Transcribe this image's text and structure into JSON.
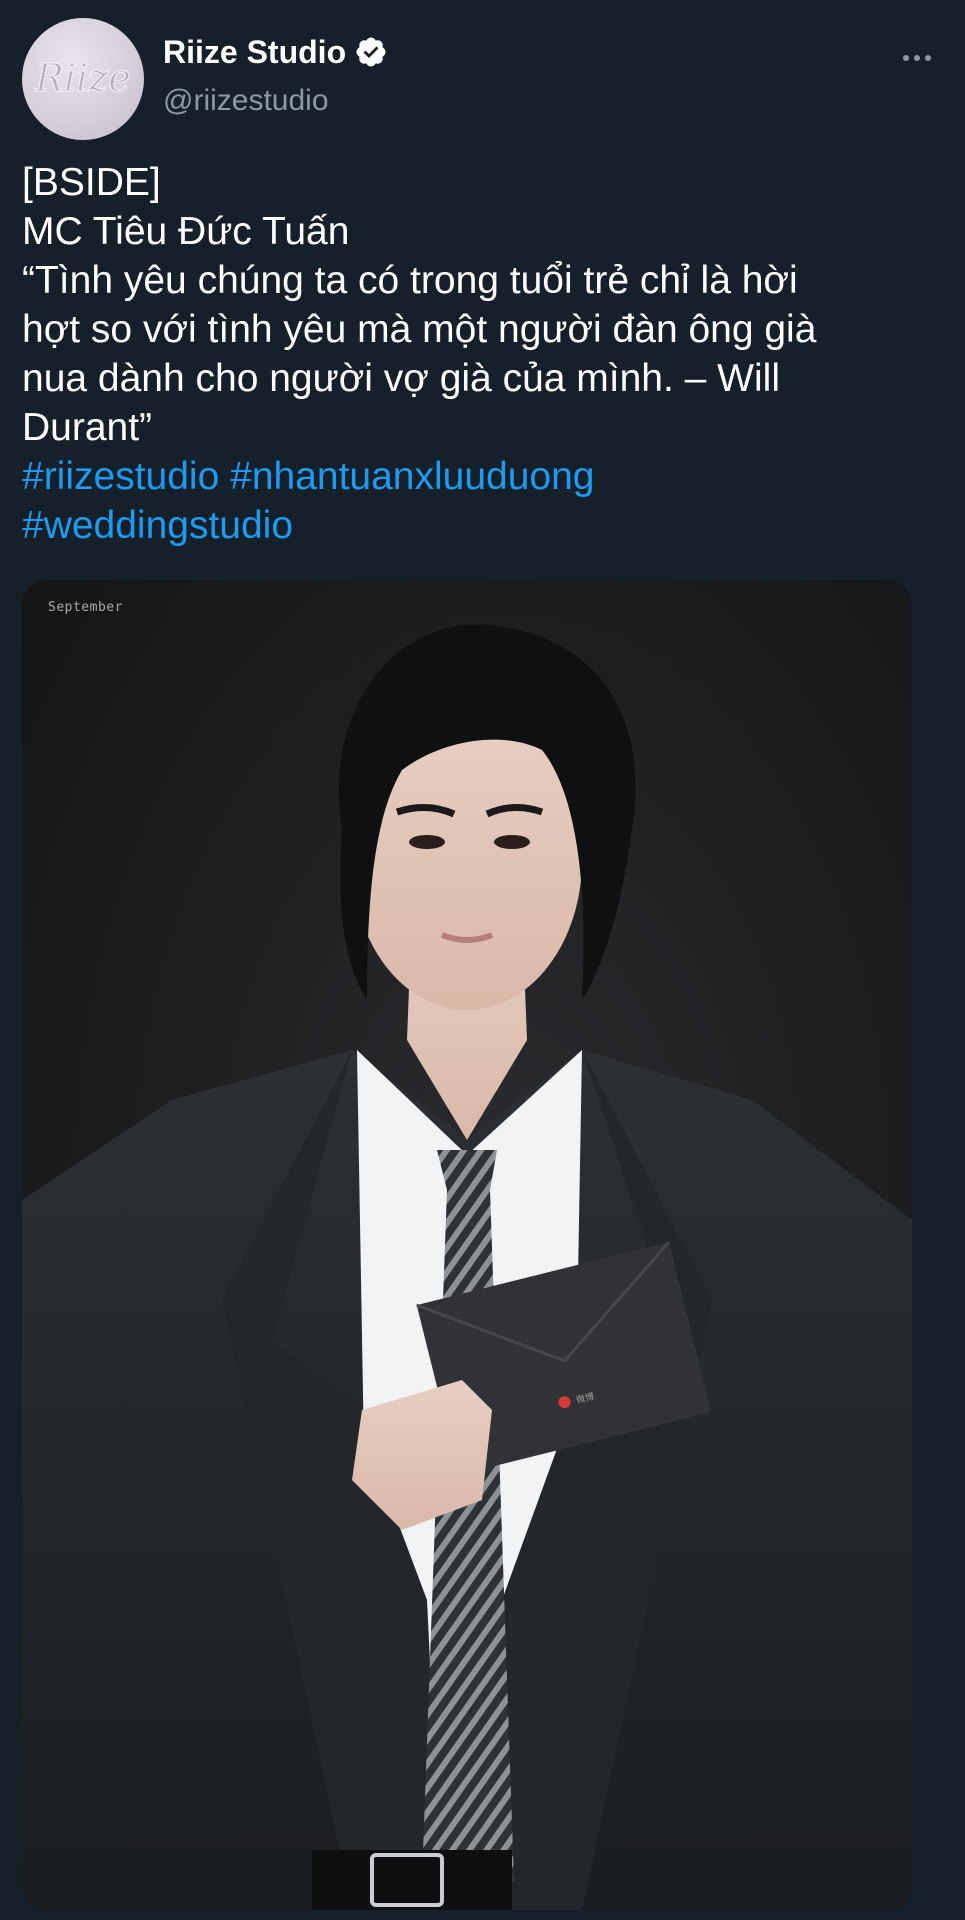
{
  "account": {
    "display_name": "Riize Studio",
    "handle": "@riizestudio",
    "avatar_logo_text": "Riize",
    "verified": true
  },
  "tweet": {
    "lines": [
      "[BSIDE]",
      "MC Tiêu Đức Tuấn",
      "“Tình yêu chúng ta có trong tuổi trẻ chỉ là hời",
      "hợt so với tình yêu mà một người đàn ông già",
      "nua dành cho người vợ già của mình. – Will",
      "Durant”"
    ],
    "hashtags": [
      "#riizestudio",
      "#nhantuanxluuduong",
      "#weddingstudio"
    ]
  },
  "media": {
    "watermark": "September",
    "envelope_logo_text": "微博"
  },
  "colors": {
    "background": "#15202b",
    "hashtag": "#1d9bf0",
    "secondary_text": "#8b98a5",
    "verified_badge": "#ffffff"
  },
  "icons": {
    "more": "more-horizontal-icon",
    "verified": "verified-badge-icon"
  }
}
